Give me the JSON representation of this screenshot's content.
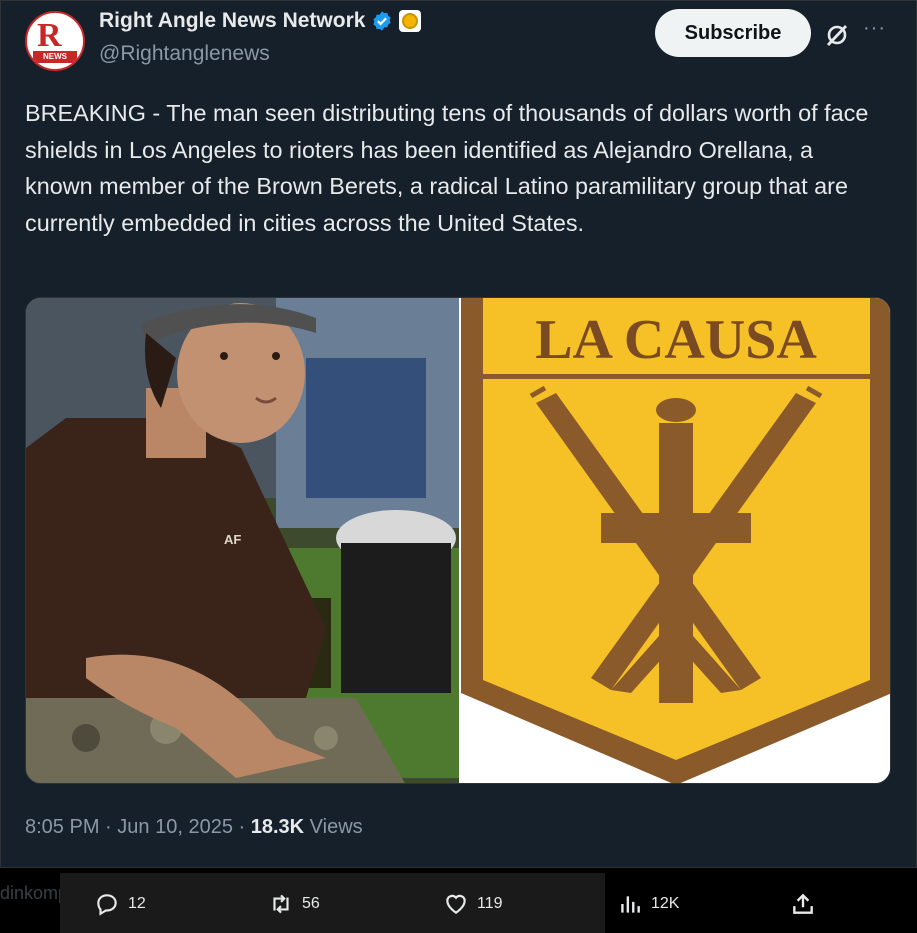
{
  "account": {
    "display_name": "Right Angle News Network",
    "handle": "@Rightanglenews",
    "avatar_letter": "R",
    "avatar_banner": "NEWS"
  },
  "header": {
    "subscribe_label": "Subscribe",
    "more_label": "···"
  },
  "tweet": {
    "text": "BREAKING - The man seen distributing tens of thousands of dollars worth of face shields in Los Angeles to rioters has been identified as Alejandro Orellana, a known member of the Brown Berets, a radical Latino paramilitary group that are currently embedded in cities across the United States.",
    "image_right_text": "LA CAUSA",
    "shirt_text": "AF"
  },
  "meta": {
    "time": "8:05 PM",
    "separator": "·",
    "date": "Jun 10, 2025",
    "views_count": "18.3K",
    "views_label": "Views"
  },
  "actions": {
    "replies": "12",
    "reposts": "56",
    "likes": "119",
    "views": "12K"
  },
  "background_fragment": "dinkompu",
  "colors": {
    "background": "#15202b",
    "verified": "#1d9bf0",
    "badge_gold": "#f5c127",
    "badge_brown": "#8b5a2b"
  }
}
